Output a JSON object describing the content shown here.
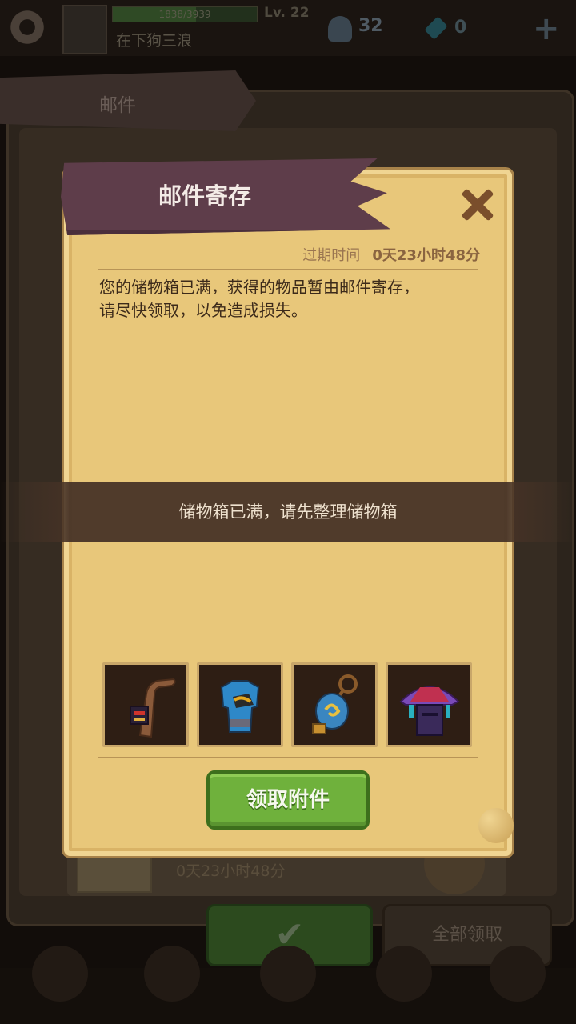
{
  "status_bar": {
    "xp_text": "1838/3939",
    "level": "Lv. 22",
    "player_name": "在下狗三浪",
    "resource_1_value": "32",
    "resource_2_value": "0",
    "icons": [
      "gear-icon",
      "ankh-icon",
      "gem-icon",
      "plus-icon"
    ]
  },
  "mail_panel": {
    "tab_title": "邮件",
    "item_time": "0天23小时48分",
    "confirm_icon": "checkmark-icon",
    "claim_all_label": "全部领取"
  },
  "modal": {
    "title": "邮件寄存",
    "close_icon": "close-icon",
    "expiry_label": "过期时间",
    "expiry_value": "0天23小时48分",
    "message_line1": "您的储物箱已满，获得的物品暂由邮件寄存，",
    "message_line2": "请尽快领取，以免造成损失。",
    "attachments": [
      {
        "icon": "staff-icon"
      },
      {
        "icon": "armor-icon"
      },
      {
        "icon": "amulet-icon"
      },
      {
        "icon": "helmet-icon"
      }
    ],
    "claim_button_label": "领取附件"
  },
  "toast": {
    "text": "储物箱已满，请先整理储物箱"
  },
  "colors": {
    "parchment": "#e8c77a",
    "banner": "#5e3d4a",
    "claim_green": "#6fb13c",
    "close_brown": "#7a4e2c"
  }
}
